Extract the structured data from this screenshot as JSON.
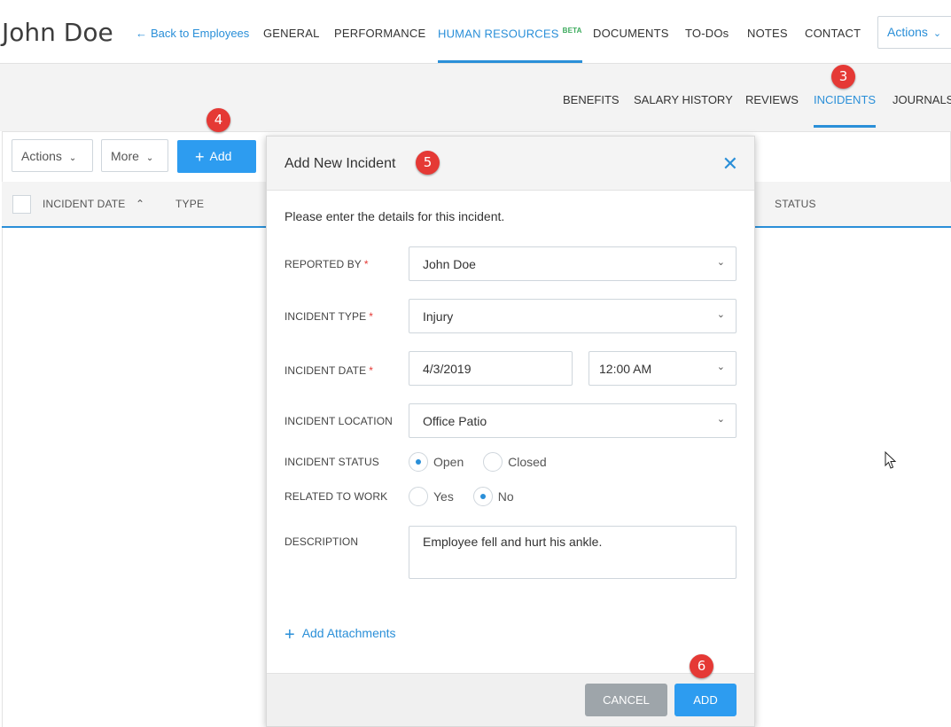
{
  "header": {
    "employee_name": "John Doe",
    "back_link": "Back to Employees",
    "tabs": [
      {
        "label": "GENERAL"
      },
      {
        "label": "PERFORMANCE"
      },
      {
        "label": "HUMAN RESOURCES",
        "badge": "BETA",
        "active": true
      },
      {
        "label": "DOCUMENTS"
      },
      {
        "label": "TO-DOs"
      },
      {
        "label": "NOTES"
      },
      {
        "label": "CONTACT"
      }
    ],
    "actions_label": "Actions"
  },
  "subtabs": [
    {
      "label": "BENEFITS"
    },
    {
      "label": "SALARY HISTORY"
    },
    {
      "label": "REVIEWS"
    },
    {
      "label": "INCIDENTS",
      "active": true
    },
    {
      "label": "JOURNALS"
    }
  ],
  "toolbar": {
    "actions_label": "Actions",
    "more_label": "More",
    "add_label": "Add"
  },
  "table": {
    "columns": [
      "INCIDENT DATE",
      "TYPE",
      "STATUS"
    ]
  },
  "steps": [
    "3",
    "4",
    "5",
    "6"
  ],
  "modal": {
    "title": "Add New Incident",
    "intro": "Please enter the details for this incident.",
    "fields": {
      "reported_by": {
        "label": "REPORTED BY",
        "value": "John Doe"
      },
      "incident_type": {
        "label": "INCIDENT TYPE",
        "value": "Injury"
      },
      "incident_date": {
        "label": "INCIDENT DATE",
        "date": "4/3/2019",
        "time": "12:00 AM"
      },
      "incident_location": {
        "label": "INCIDENT LOCATION",
        "value": "Office Patio"
      },
      "incident_status": {
        "label": "INCIDENT STATUS",
        "options": [
          "Open",
          "Closed"
        ],
        "selected": "Open"
      },
      "related_to_work": {
        "label": "RELATED TO WORK",
        "options": [
          "Yes",
          "No"
        ],
        "selected": "No"
      },
      "description": {
        "label": "DESCRIPTION",
        "value": "Employee fell and hurt his ankle."
      }
    },
    "required_mark": "*",
    "attachments_label": "Add Attachments",
    "cancel_label": "CANCEL",
    "submit_label": "ADD"
  },
  "colors": {
    "accent": "#2a8fd8",
    "primary_button": "#2d9cf0",
    "cancel_button": "#9ea5aa",
    "badge": "#e53935",
    "beta": "#3aaa5b"
  },
  "icons": {
    "back": "arrow-left-icon",
    "dropdown": "chevron-down-icon",
    "close": "close-icon",
    "add": "plus-icon",
    "sort": "chevron-up-icon"
  }
}
